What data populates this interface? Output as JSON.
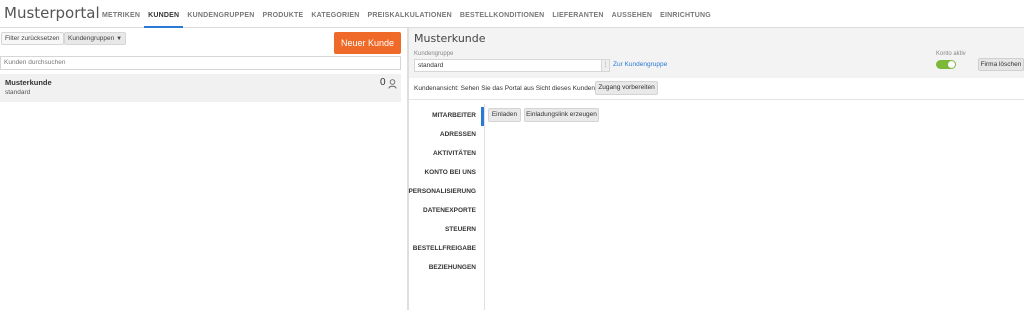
{
  "app": {
    "title": "Musterportal"
  },
  "nav": {
    "items": [
      "METRIKEN",
      "KUNDEN",
      "KUNDENGRUPPEN",
      "PRODUKTE",
      "KATEGORIEN",
      "PREISKALKULATIONEN",
      "BESTELLKONDITIONEN",
      "LIEFERANTEN",
      "AUSSEHEN",
      "EINRICHTUNG"
    ],
    "active": "KUNDEN"
  },
  "left": {
    "reset_filter": "Filter zurücksetzen",
    "group_filter": "Kundengruppen",
    "group_filter_icon": "caret-down-icon",
    "new_customer": "Neuer Kunde",
    "search_placeholder": "Kunden durchsuchen",
    "customers": [
      {
        "name": "Musterkunde",
        "group": "standard",
        "count": "0",
        "icon": "user-icon"
      }
    ]
  },
  "detail": {
    "title": "Musterkunde",
    "group_label": "Kundengruppe",
    "group_value": "standard",
    "group_link": "Zur Kundengruppe",
    "active_label": "Konto aktiv",
    "active_on": true,
    "delete_button": "Firma löschen",
    "view_text": "Kundenansicht: Sehen Sie das Portal aus Sicht dieses Kunden an.",
    "prepare_access": "Zugang vorbereiten",
    "tabs": [
      "MITARBEITER",
      "ADRESSEN",
      "AKTIVITÄTEN",
      "KONTO BEI UNS",
      "PERSONALISIERUNG",
      "DATENEXPORTE",
      "STEUERN",
      "BESTELLFREIGABE",
      "BEZIEHUNGEN"
    ],
    "active_tab": "MITARBEITER",
    "invite": "Einladen",
    "invite_link": "Einladungslink erzeugen"
  },
  "colors": {
    "accent": "#2a7ad5",
    "primary_button": "#ef6a28",
    "toggle_on": "#7cb83a"
  }
}
